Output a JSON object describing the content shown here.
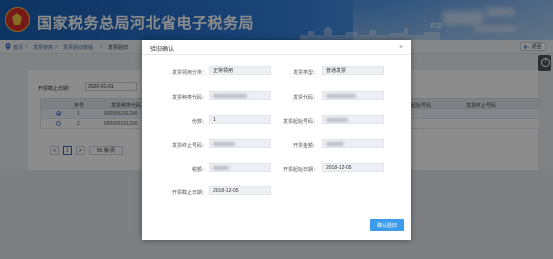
{
  "header": {
    "site_title": "国家税务总局河北省电子税务局",
    "welcome": "欢迎"
  },
  "breadcrumb": {
    "items": [
      "首页",
      "发票使用",
      "发票验旧缴销",
      "发票验旧"
    ],
    "separator": ">"
  },
  "toolbar": {
    "back_label": "返回"
  },
  "background_form": {
    "date_label": "开票截止日期：",
    "date_value": "2020-01-01"
  },
  "table": {
    "headers": [
      "序号",
      "发票种类代码",
      "发票起始号码",
      "发票终止号码"
    ],
    "rows": [
      {
        "index": "1",
        "code": "000005151200"
      },
      {
        "index": "2",
        "code": "000005151200"
      }
    ]
  },
  "pager": {
    "prev": "<",
    "page": "1",
    "next": ">",
    "page_size": "50 条/页"
  },
  "modal": {
    "title": "验旧确认",
    "close": "×",
    "fields": {
      "invoice_category": {
        "label": "发票领用分类：",
        "value": "正常领用"
      },
      "invoice_type": {
        "label": "发票类型：",
        "value": "普通发票"
      },
      "type_code": {
        "label": "发票种类代码：",
        "value": ""
      },
      "invoice_code": {
        "label": "发票代码：",
        "value": ""
      },
      "count": {
        "label": "份数：",
        "value": "1"
      },
      "start_no": {
        "label": "发票起始号码：",
        "value": ""
      },
      "end_no": {
        "label": "发票终止号码：",
        "value": ""
      },
      "amount": {
        "label": "开票金额：",
        "value": ""
      },
      "tax": {
        "label": "税额：",
        "value": ""
      },
      "start_date": {
        "label": "开票起始日期：",
        "value": "2018-12-05"
      },
      "end_date": {
        "label": "开票截止日期：",
        "value": "2018-12-05"
      }
    },
    "confirm_label": "确认验旧"
  },
  "colors": {
    "header_blue": "#1a5fb4",
    "accent": "#3d9be9"
  }
}
